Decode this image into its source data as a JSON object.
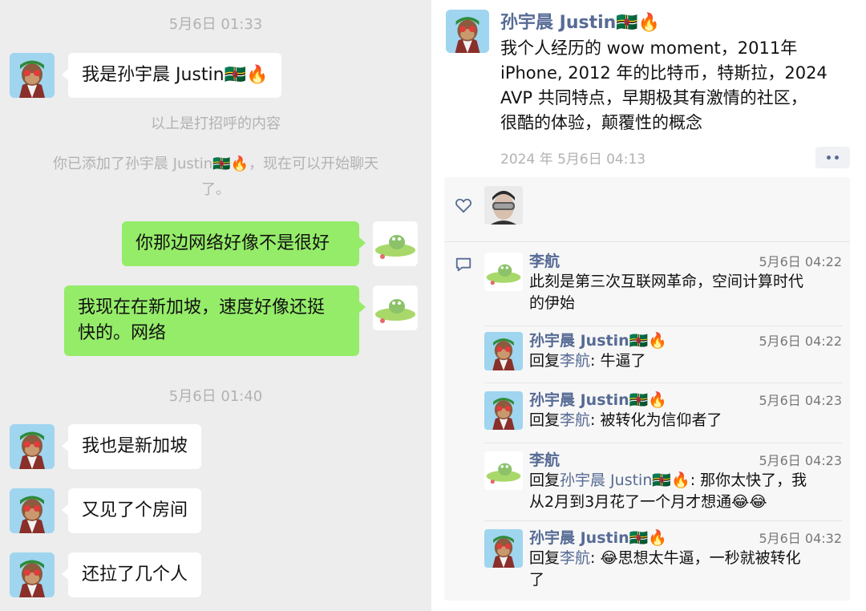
{
  "chat": {
    "timestamp_1": "5月6日 01:33",
    "timestamp_2": "5月6日 01:40",
    "greeting_message": "我是孙宇晨 Justin🇩🇲🔥",
    "system_notice_1": "以上是打招呼的内容",
    "system_notice_2_line1": "你已添加了孙宇晨 Justin🇩🇲🔥，现在可以开始聊天",
    "system_notice_2_line2": "了。",
    "messages": [
      {
        "side": "out",
        "text": "你那边网络好像不是很好"
      },
      {
        "side": "out",
        "text_line1": "我现在在新加坡，速度好像还挺",
        "text_line2": "快的。网络"
      },
      {
        "side": "in",
        "text": "我也是新加坡"
      },
      {
        "side": "in",
        "text": "又见了个房间"
      },
      {
        "side": "in",
        "text": "还拉了几个人"
      }
    ]
  },
  "moment": {
    "author": "孙宇晨 Justin🇩🇲🔥",
    "text_lines": [
      "我个人经历的 wow moment，2011年",
      "iPhone, 2012 年的比特币，特斯拉，2024",
      "AVP 共同特点，早期极其有激情的社区，",
      "很酷的体验，颠覆性的概念"
    ],
    "time": "2024 年 5月6日 04:13",
    "like_icon": "heart-icon",
    "comment_icon": "comment-icon",
    "more_icon": "more-dots-icon",
    "comments": [
      {
        "author": "李航",
        "time": "5月6日 04:22",
        "text_line1": "此刻是第三次互联网革命，空间计算时代",
        "text_line2": "的伊始"
      },
      {
        "author": "孙宇晨 Justin🇩🇲🔥",
        "time": "5月6日 04:22",
        "reply_prefix": "回复",
        "reply_to": "李航",
        "reply_text": ": 牛逼了"
      },
      {
        "author": "孙宇晨 Justin🇩🇲🔥",
        "time": "5月6日 04:23",
        "reply_prefix": "回复",
        "reply_to": "李航",
        "reply_text": ": 被转化为信仰者了"
      },
      {
        "author": "李航",
        "time": "5月6日 04:23",
        "reply_prefix": "回复",
        "reply_to": "孙宇晨 Justin🇩🇲🔥",
        "reply_text_line1": ": 那你太快了，我",
        "reply_text_line2": "从2月到3月花了一个月才想通😂😂"
      },
      {
        "author": "孙宇晨 Justin🇩🇲🔥",
        "time": "5月6日 04:32",
        "reply_prefix": "回复",
        "reply_to": "李航",
        "reply_text_line1": ": 😂思想太牛逼，一秒就被转化",
        "reply_text_line2": "了"
      }
    ]
  },
  "colors": {
    "chat_bg": "#ededed",
    "outgoing_bubble": "#95ec69",
    "incoming_bubble": "#ffffff",
    "link_name": "#576b95",
    "meta_gray": "#b2b2b2"
  }
}
